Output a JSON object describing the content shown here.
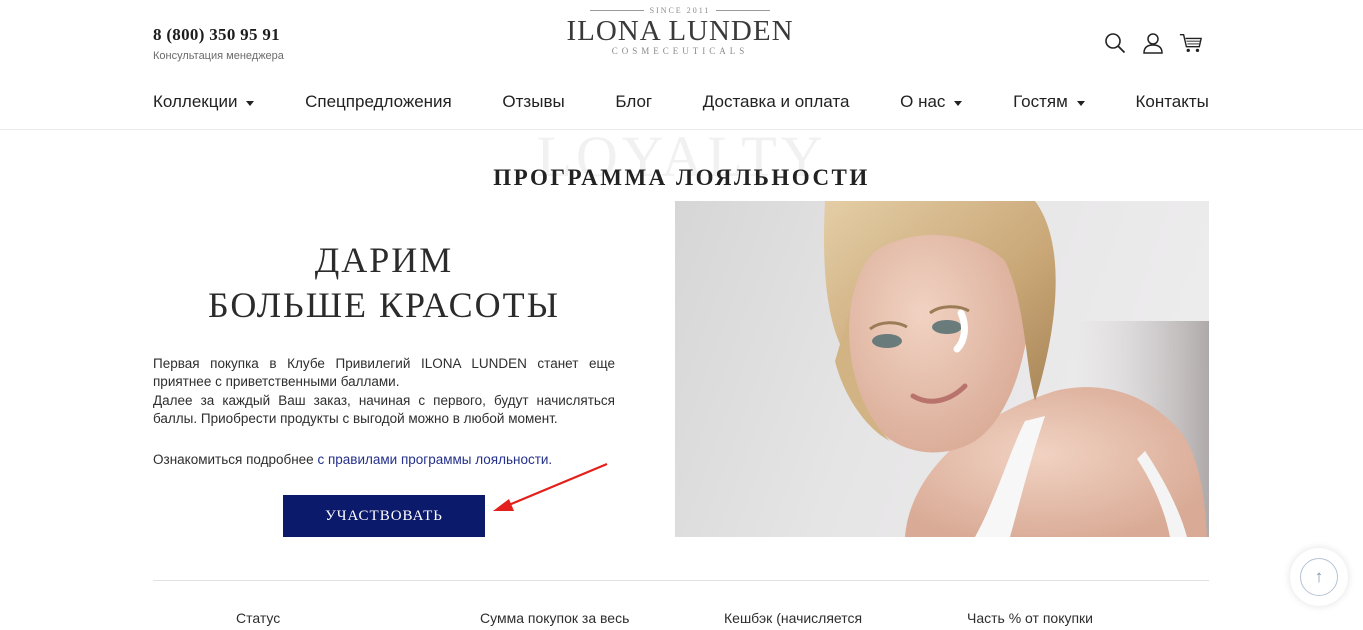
{
  "header": {
    "phone": "8 (800) 350 95 91",
    "phone_caption": "Консультация менеджера",
    "logo": {
      "since": "SINCE 2011",
      "name": "ILONA LUNDEN",
      "sub": "COSMECEUTICALS"
    },
    "icons": [
      "search-icon",
      "user-icon",
      "cart-icon"
    ]
  },
  "nav": {
    "items": [
      {
        "label": "Коллекции",
        "dropdown": true
      },
      {
        "label": "Спецпредложения",
        "dropdown": false
      },
      {
        "label": "Отзывы",
        "dropdown": false
      },
      {
        "label": "Блог",
        "dropdown": false
      },
      {
        "label": "Доставка и оплата",
        "dropdown": false
      },
      {
        "label": "О нас",
        "dropdown": true
      },
      {
        "label": "Гостям",
        "dropdown": true
      },
      {
        "label": "Контакты",
        "dropdown": false
      }
    ]
  },
  "section": {
    "bg_word": "LOYALTY",
    "title": "ПРОГРАММА ЛОЯЛЬНОСТИ"
  },
  "hero": {
    "title_line1": "ДАРИМ",
    "title_line2": "БОЛЬШЕ КРАСОТЫ",
    "paragraph1": "Первая покупка в Клубе Привилегий ILONA LUNDEN станет еще приятнее с приветственными баллами.",
    "paragraph2": "Далее за каждый Ваш заказ, начиная с первого, будут начисляться баллы. Приобрести продукты с выгодой можно в любой момент.",
    "rules_prefix": "Ознакомиться подробнее ",
    "rules_link": "с правилами программы лояльности.",
    "cta": "УЧАСТВОВАТЬ"
  },
  "table": {
    "headers": [
      "Статус",
      "Сумма покупок за весь",
      "Кешбэк (начисляется",
      "Часть % от покупки"
    ]
  },
  "colors": {
    "cta_bg": "#0c1a6b",
    "link": "#24308a",
    "arrow": "#e3201b"
  }
}
